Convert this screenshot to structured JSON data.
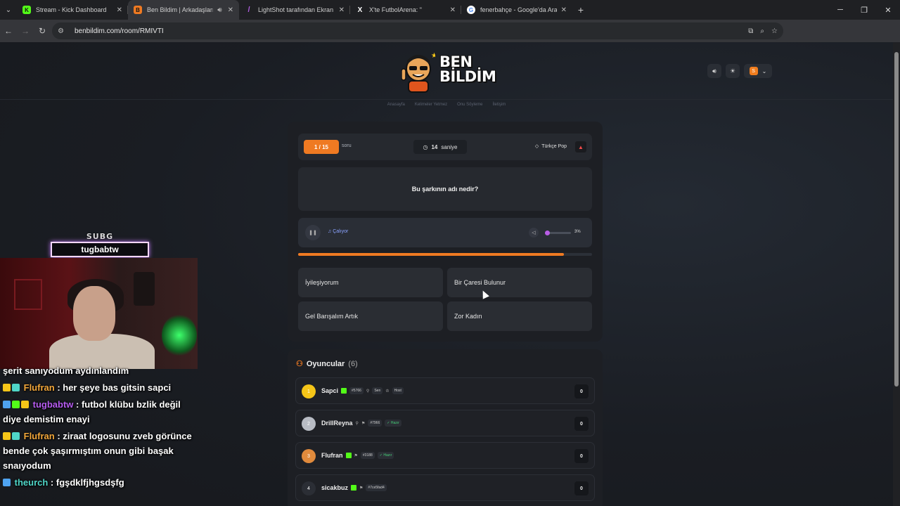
{
  "browser": {
    "tabs": [
      {
        "title": "Stream - Kick Dashboard",
        "favicon_color": "#53fc18",
        "favicon_char": "K",
        "active": false
      },
      {
        "title": "Ben Bildim | Arkadaşlarınla",
        "favicon_color": "#ef7a22",
        "favicon_char": "B",
        "active": true
      },
      {
        "title": "LightShot tarafından Ekran Gör",
        "favicon_color": "#b05de0",
        "favicon_char": "/",
        "active": false
      },
      {
        "title": "X'te FutbolArena: \"",
        "favicon_color": "#ffffff",
        "favicon_char": "X",
        "active": false
      },
      {
        "title": "fenerbahçe - Google'da Ara",
        "favicon_color": "#ffffff",
        "favicon_char": "G",
        "active": false
      }
    ],
    "url": "benbildim.com/room/RMIVTI",
    "new_tab_icon": "plus-icon"
  },
  "site": {
    "logo_line1": "BEN",
    "logo_line2": "BİLDİM",
    "nav": [
      "Anasayfa",
      "Kelimeler Yetmez",
      "Onu Söyleme",
      "İletişim"
    ],
    "profile_initial": "S"
  },
  "game": {
    "question_counter": "1 / 15",
    "question_word": "soru",
    "timer_value": "14",
    "timer_unit": "saniye",
    "category": "Türkçe Pop",
    "question": "Bu şarkının adı nedir?",
    "player_status": "Çalıyor",
    "volume_label": "3%",
    "volume_fraction": 0.03,
    "progress_fraction": 0.905,
    "answers": [
      "İyileşiyorum",
      "Bir Çaresi Bulunur",
      "Gel Barışalım Artık",
      "Zor Kadın"
    ]
  },
  "players": {
    "title": "Oyuncular",
    "count": "(6)",
    "list": [
      {
        "rank": "1",
        "name": "Sapci",
        "id": "#5766",
        "tags": [
          "Sen",
          "Host"
        ],
        "score": "0",
        "rank_color": "#f5c518"
      },
      {
        "rank": "2",
        "name": "DrillReyna",
        "id": "#7966",
        "tags": [
          "Hazır"
        ],
        "score": "0",
        "rank_color": "#b8bcc4"
      },
      {
        "rank": "3",
        "name": "Flufran",
        "id": "#3188",
        "tags": [
          "Hazır"
        ],
        "score": "0",
        "rank_color": "#e08a3c"
      },
      {
        "rank": "4",
        "name": "sicakbuz",
        "id": "#7ce5fad4",
        "tags": [],
        "score": "0",
        "rank_color": "#2b2e35"
      }
    ]
  },
  "stream": {
    "sub_goal_label": "SUBG",
    "sub_name": "tugbabtw",
    "chat": [
      {
        "user": "theurch",
        "color": "#4fd6c8",
        "text": "şerit sanıyodum aydınlandım"
      },
      {
        "user": "Flufran",
        "color": "#f2a73a",
        "text": ": her şeye bas gitsin sapci"
      },
      {
        "user": "tugbabtw",
        "color": "#b65cf0",
        "text": ": futbol klübu bzlik değil diye demistim enayi"
      },
      {
        "user": "Flufran",
        "color": "#f2a73a",
        "text": ": ziraat logosunu zveb görünce bende çok şaşırmıştım onun gibi başak snaıyodum"
      },
      {
        "user": "theurch",
        "color": "#4fd6c8",
        "text": ": fgşdklfjhgsdşfg"
      }
    ]
  }
}
